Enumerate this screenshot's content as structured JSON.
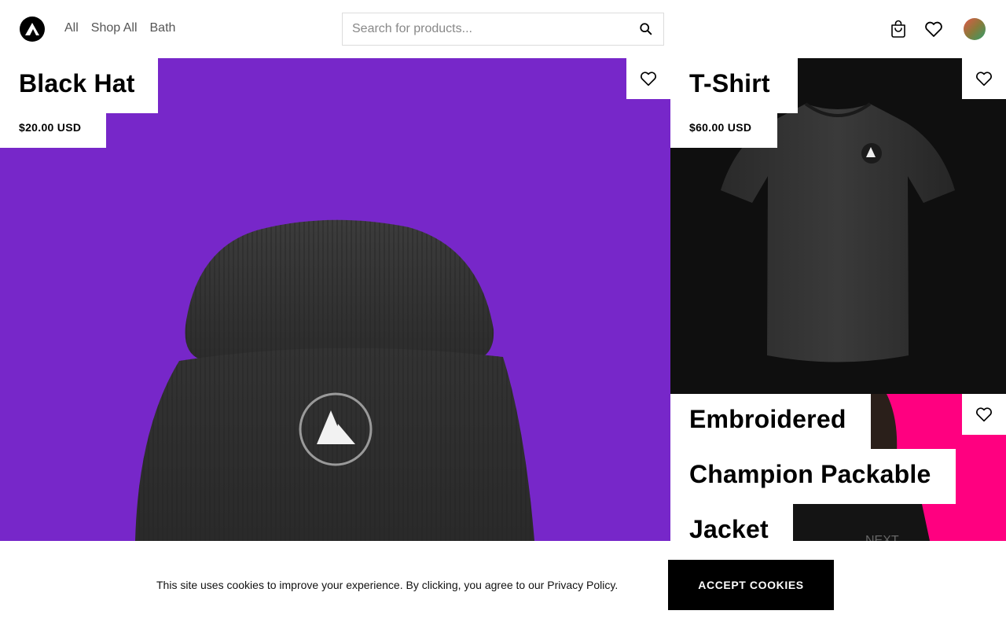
{
  "header": {
    "nav": [
      "All",
      "Shop All",
      "Bath"
    ],
    "search_placeholder": "Search for products...",
    "icons": [
      "logo-icon",
      "search-icon",
      "cart-icon",
      "heart-icon",
      "avatar"
    ]
  },
  "products": {
    "hat": {
      "title": "Black Hat",
      "price": "$20.00 USD",
      "bg": "#7727c9"
    },
    "tee": {
      "title": "T-Shirt",
      "price": "$60.00 USD",
      "bg": "#0f0f0f"
    },
    "jacket": {
      "title_lines": [
        "Embroidered",
        "Champion Packable",
        "Jacket"
      ],
      "bg": "#ff0080",
      "print_text": "NEXT"
    }
  },
  "cookie": {
    "text": "This site uses cookies to improve your experience. By clicking, you agree to our Privacy Policy.",
    "button": "ACCEPT COOKIES"
  }
}
